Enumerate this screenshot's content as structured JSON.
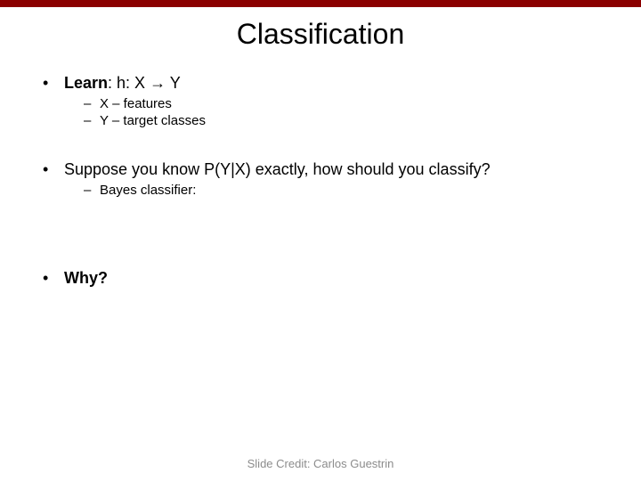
{
  "title": "Classification",
  "bullets": {
    "learn_label": "Learn",
    "learn_rest": ": h: X ",
    "learn_arrow": "→",
    "learn_target": "    Y",
    "x_feat": "X – features",
    "y_target": "Y – target classes",
    "suppose": "Suppose you know P(Y|X) exactly, how should you classify?",
    "bayes": "Bayes classifier:",
    "why": "Why?"
  },
  "footer": "Slide Credit: Carlos Guestrin"
}
